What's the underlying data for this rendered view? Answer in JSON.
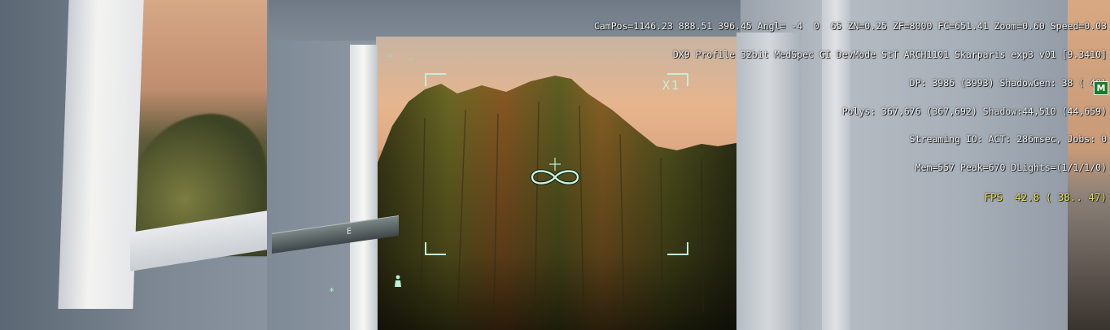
{
  "debug_overlay": {
    "lines": [
      "CamPos=1146.23 888.51 396.45 Angl= -4  0  65 ZN=0.25 ZF=8000 FC=651.41 Zoom=0.60 Speed=0.03",
      "DX9 Profile 32bit MedSpec GI DevMode StT ARCH1101 Skarparis exp3 v01 [9.3410]",
      "DP: 3986 (3993) ShadowGen: 38 ( 40)",
      "Polys: 367,676 (367,692) Shadow:44,510 (44,659)",
      "Streaming IO: ACT: 286msec, Jobs: 0",
      "Mem=557 Peak=670 DLights=(1/1/1/0)"
    ],
    "fps": "FPS  42.8 ( 38.. 47)",
    "fps_color": "#f0e04a",
    "text_color": "#f2f4f6"
  },
  "badge": {
    "label": "M",
    "color": "#1c7a2c"
  },
  "scope": {
    "zoom_indicator": "X1",
    "reticle_icon": "infinity-reticle-icon",
    "hud_color": "#c3efd8"
  },
  "blade_marker": "E",
  "icons": {
    "player": "player-icon",
    "wind": "wind-icon",
    "eye": "eye-icon"
  }
}
